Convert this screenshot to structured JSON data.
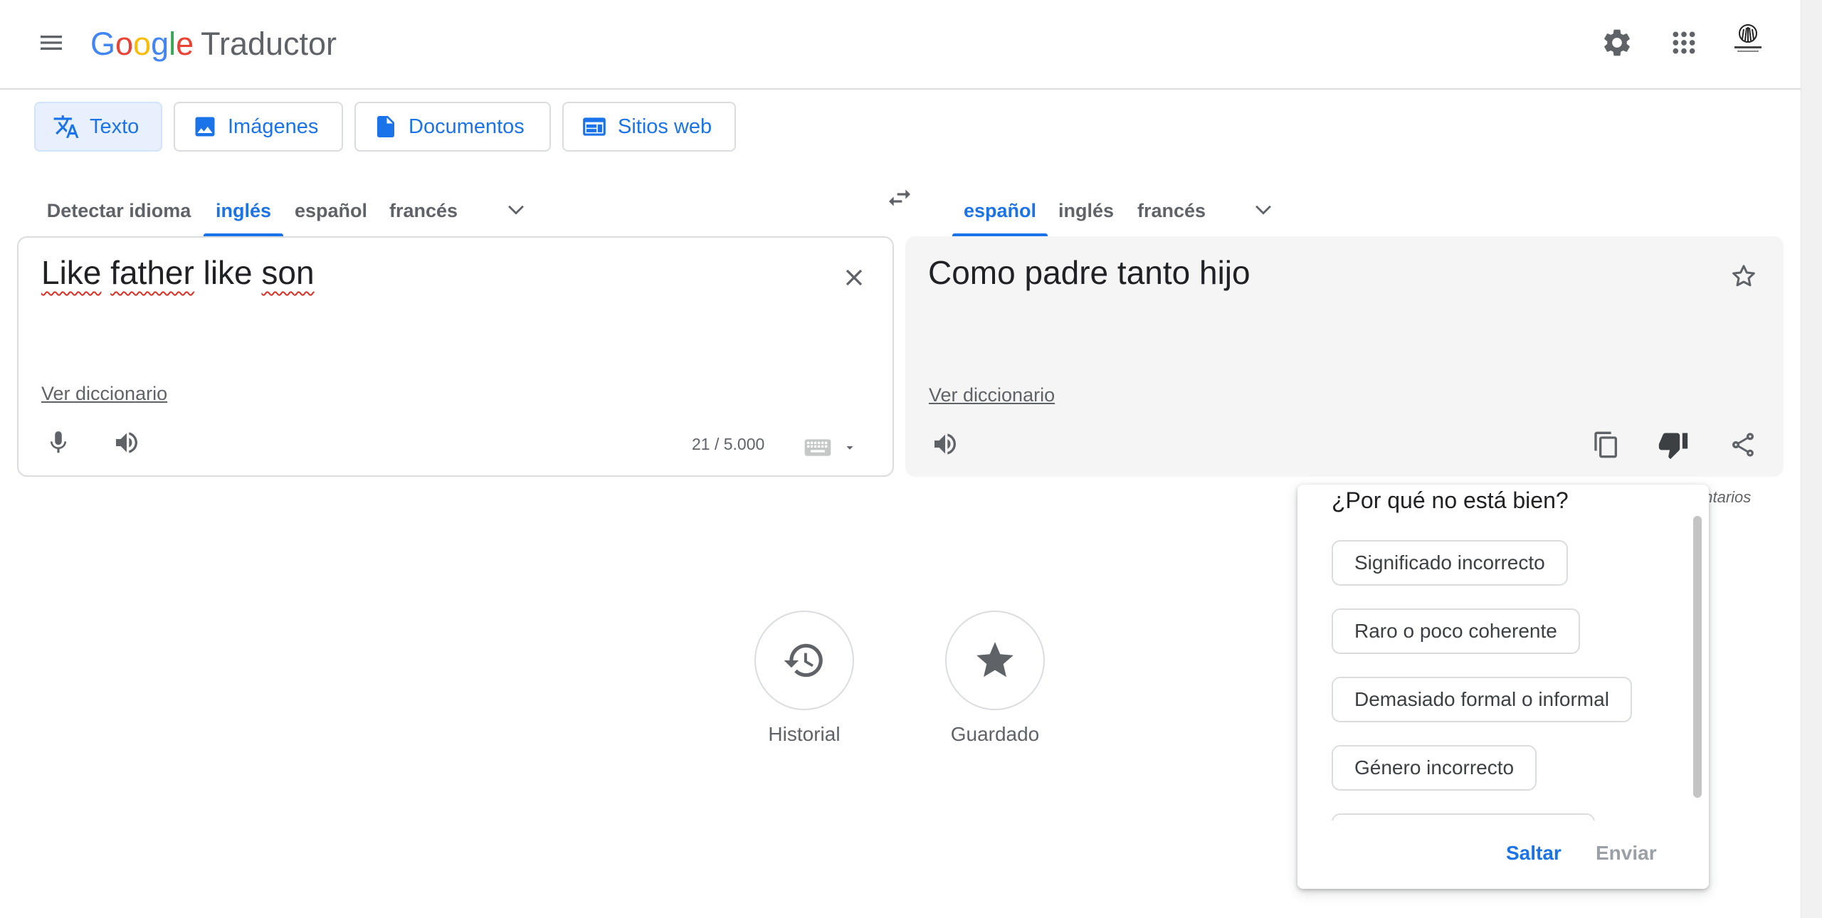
{
  "header": {
    "logo_letters": [
      {
        "ch": "G",
        "color": "#4285F4"
      },
      {
        "ch": "o",
        "color": "#EA4335"
      },
      {
        "ch": "o",
        "color": "#FBBC05"
      },
      {
        "ch": "g",
        "color": "#4285F4"
      },
      {
        "ch": "l",
        "color": "#34A853"
      },
      {
        "ch": "e",
        "color": "#EA4335"
      }
    ],
    "product": "Traductor"
  },
  "modes": [
    {
      "label": "Texto",
      "icon": "translate-icon",
      "active": true
    },
    {
      "label": "Imágenes",
      "icon": "image-icon",
      "active": false
    },
    {
      "label": "Documentos",
      "icon": "document-icon",
      "active": false
    },
    {
      "label": "Sitios web",
      "icon": "website-icon",
      "active": false
    }
  ],
  "source_langs": [
    "Detectar idioma",
    "inglés",
    "español",
    "francés"
  ],
  "source_active": "inglés",
  "target_langs": [
    "español",
    "inglés",
    "francés"
  ],
  "target_active": "español",
  "source": {
    "words": [
      "Like",
      "father",
      "like",
      "son"
    ],
    "misspelled": [
      true,
      true,
      false,
      true
    ],
    "dict_link": "Ver diccionario",
    "counter": "21 / 5.000"
  },
  "target": {
    "text": "Como padre tanto hijo",
    "dict_link": "Ver diccionario"
  },
  "side_note": "entarios",
  "history": {
    "historial": "Historial",
    "guardado": "Guardado"
  },
  "feedback": {
    "title": "¿Por qué no está bien?",
    "options": [
      "Significado incorrecto",
      "Raro o poco coherente",
      "Demasiado formal o informal",
      "Género incorrecto",
      ""
    ],
    "skip": "Saltar",
    "send": "Enviar"
  },
  "colors": {
    "accent": "#1a73e8",
    "accent_bg": "#e8f0fe",
    "border": "#dadce0",
    "panel_bg": "#f5f5f5",
    "spell_error": "#d93025"
  }
}
